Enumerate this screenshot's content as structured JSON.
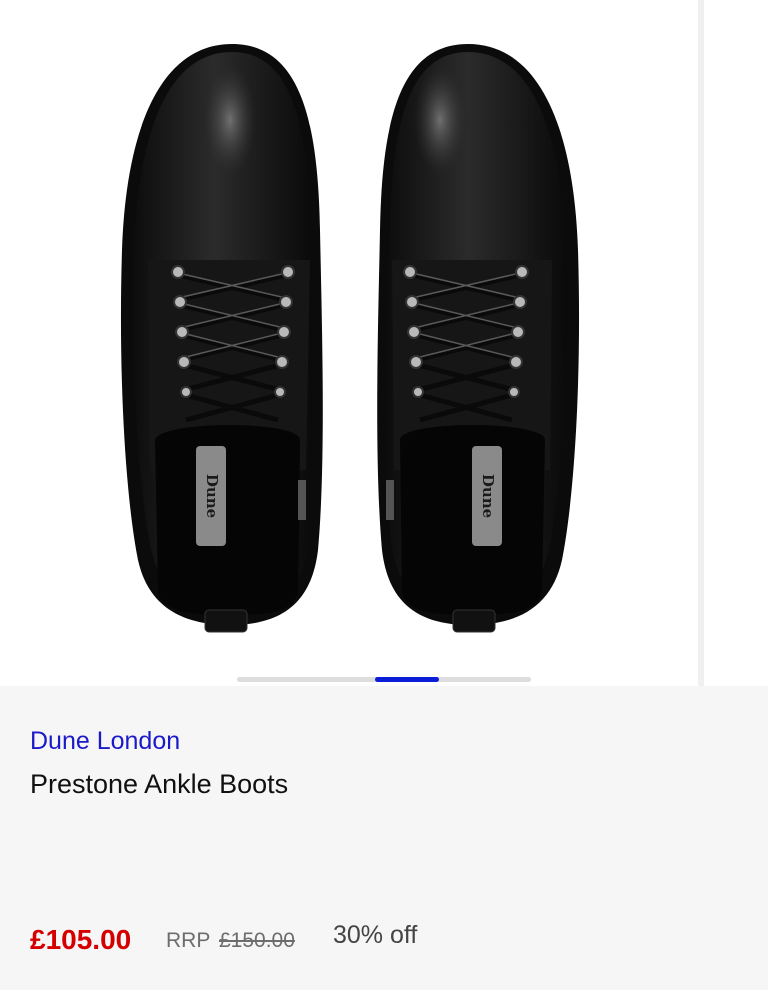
{
  "product": {
    "brand": "Dune London",
    "title": "Prestone Ankle Boots",
    "image_alt": "Pair of black leather lace-up ankle boots viewed from above",
    "insole_logo": "Dune",
    "price": {
      "current": "£105.00",
      "rrp_label": "RRP",
      "rrp_value": "£150.00",
      "discount": "30% off"
    }
  },
  "gallery": {
    "progress_fraction": 0.6,
    "indicator_color": "#0a1ed8"
  },
  "colors": {
    "brand_link": "#1a1ac9",
    "price": "#d40000",
    "background": "#f6f6f6"
  }
}
